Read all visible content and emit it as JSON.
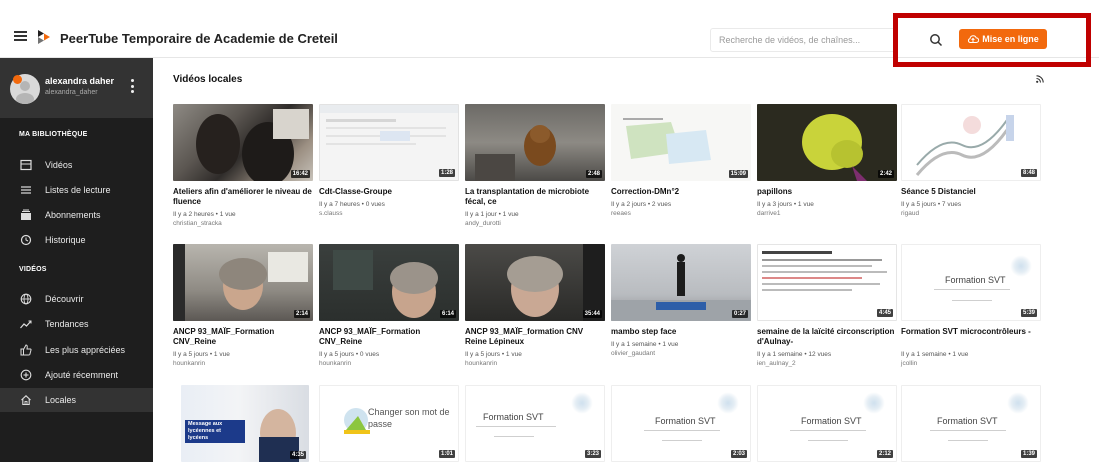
{
  "header": {
    "title": "PeerTube Temporaire de Academie de Creteil",
    "search_placeholder": "Recherche de vidéos, de chaînes...",
    "upload_label": "Mise en ligne",
    "accent_color": "#f2690d",
    "highlight_color": "#c00000"
  },
  "user": {
    "name": "alexandra daher",
    "handle": "alexandra_daher"
  },
  "sidebar": {
    "library_title": "MA BIBLIOTHÈQUE",
    "library_items": [
      {
        "label": "Vidéos",
        "icon": "videos-icon"
      },
      {
        "label": "Listes de lecture",
        "icon": "playlist-icon"
      },
      {
        "label": "Abonnements",
        "icon": "subscriptions-icon"
      },
      {
        "label": "Historique",
        "icon": "history-icon"
      }
    ],
    "videos_title": "VIDÉOS",
    "videos_items": [
      {
        "label": "Découvrir",
        "icon": "globe-icon"
      },
      {
        "label": "Tendances",
        "icon": "trending-icon"
      },
      {
        "label": "Les plus appréciées",
        "icon": "thumbs-up-icon"
      },
      {
        "label": "Ajouté récemment",
        "icon": "plus-circle-icon"
      },
      {
        "label": "Locales",
        "icon": "home-icon",
        "active": true
      }
    ]
  },
  "main": {
    "title": "Vidéos locales",
    "videos": [
      {
        "title": "Ateliers afin d'améliorer le niveau de fluence",
        "meta": "Il y a 2 heures • 1 vue",
        "account": "christian_stracka",
        "duration": "16:42"
      },
      {
        "title": "Cdt-Classe-Groupe",
        "meta": "Il y a 7 heures • 0 vues",
        "account": "s.clauss",
        "duration": "1:28"
      },
      {
        "title": "La transplantation de microbiote fécal, ce",
        "meta": "Il y a 1 jour • 1 vue",
        "account": "andy_durotti",
        "duration": "2:48"
      },
      {
        "title": "Correction-DMn°2",
        "meta": "Il y a 2 jours • 2 vues",
        "account": "reeaes",
        "duration": "15:09"
      },
      {
        "title": "papillons",
        "meta": "Il y a 3 jours • 1 vue",
        "account": "darrive1",
        "duration": "2:42"
      },
      {
        "title": "Séance 5 Distanciel",
        "meta": "Il y a 5 jours • 7 vues",
        "account": "rigaud",
        "duration": "8:48"
      },
      {
        "title": "ANCP 93_MAÏF_Formation CNV_Reine",
        "meta": "Il y a 5 jours • 1 vue",
        "account": "hounkanrin",
        "duration": "2:14"
      },
      {
        "title": "ANCP 93_MAÏF_Formation CNV_Reine",
        "meta": "Il y a 5 jours • 0 vues",
        "account": "hounkanrin",
        "duration": "6:14"
      },
      {
        "title": "ANCP 93_MAÏF_formation CNV Reine Lépineux",
        "meta": "Il y a 5 jours • 1 vue",
        "account": "hounkanrin",
        "duration": "35:44"
      },
      {
        "title": "mambo step face",
        "meta": "Il y a 1 semaine • 1 vue",
        "account": "olivier_gaudant",
        "duration": "0:27"
      },
      {
        "title": "semaine de la laïcité circonscription d'Aulnay-",
        "meta": "Il y a 1 semaine • 12 vues",
        "account": "ien_aulnay_2",
        "duration": "4:45"
      },
      {
        "title": "Formation SVT microcontrôleurs -",
        "meta": "Il y a 1 semaine • 1 vue",
        "account": "jcollin",
        "duration": "5:39"
      },
      {
        "thumb_text": "Message aux lycéennes et lycéens",
        "duration": "4:35"
      },
      {
        "thumb_text": "Changer son mot de passe",
        "duration": "1:01"
      },
      {
        "thumb_text": "Formation SVT",
        "duration": "3:23"
      },
      {
        "thumb_text": "Formation SVT",
        "duration": "2:03"
      },
      {
        "thumb_text": "Formation SVT",
        "duration": "2:12"
      },
      {
        "thumb_text": "Formation SVT",
        "duration": "1:39"
      }
    ]
  }
}
